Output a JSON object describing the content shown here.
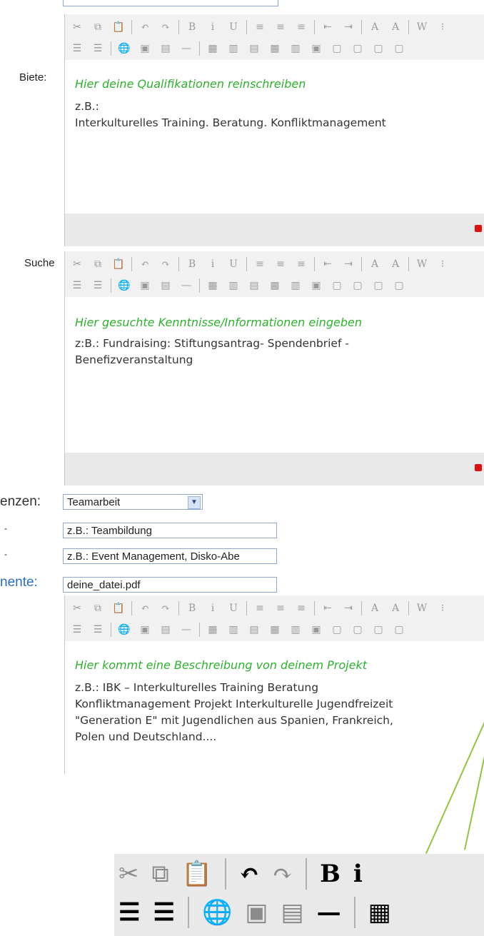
{
  "toolbar": {
    "row1": [
      {
        "name": "cut-icon",
        "glyph": "✂"
      },
      {
        "name": "copy-icon",
        "glyph": "⧉"
      },
      {
        "name": "paste-icon",
        "glyph": "📋"
      },
      {
        "sep": true
      },
      {
        "name": "undo-icon",
        "glyph": "↶"
      },
      {
        "name": "redo-icon",
        "glyph": "↷"
      },
      {
        "sep": true
      },
      {
        "name": "bold-icon",
        "glyph": "B"
      },
      {
        "name": "italic-icon",
        "glyph": "i"
      },
      {
        "name": "underline-icon",
        "glyph": "U"
      },
      {
        "sep": true
      },
      {
        "name": "align-left-icon",
        "glyph": "≡"
      },
      {
        "name": "align-center-icon",
        "glyph": "≡"
      },
      {
        "name": "align-right-icon",
        "glyph": "≡"
      },
      {
        "sep": true
      },
      {
        "name": "outdent-icon",
        "glyph": "⇤"
      },
      {
        "name": "indent-icon",
        "glyph": "⇥"
      },
      {
        "sep": true
      },
      {
        "name": "text-color-icon",
        "glyph": "A"
      },
      {
        "name": "highlight-color-icon",
        "glyph": "A"
      },
      {
        "sep": true
      },
      {
        "name": "word-paste-icon",
        "glyph": "W"
      },
      {
        "name": "grid-icon",
        "glyph": "⁝"
      }
    ],
    "row2": [
      {
        "name": "numbered-list-icon",
        "glyph": "☰"
      },
      {
        "name": "bullet-list-icon",
        "glyph": "☰"
      },
      {
        "sep": true
      },
      {
        "name": "link-icon",
        "glyph": "🌐"
      },
      {
        "name": "image-icon",
        "glyph": "▣"
      },
      {
        "name": "media-icon",
        "glyph": "▤"
      },
      {
        "name": "horizontal-rule-icon",
        "glyph": "—"
      },
      {
        "sep": true
      },
      {
        "name": "table-insert-icon",
        "glyph": "▦"
      },
      {
        "name": "table-props-icon",
        "glyph": "▥"
      },
      {
        "name": "row-insert-icon",
        "glyph": "▤"
      },
      {
        "name": "row-delete-icon",
        "glyph": "▦"
      },
      {
        "name": "column-icon",
        "glyph": "▥"
      },
      {
        "name": "cell-icon",
        "glyph": "▣"
      },
      {
        "name": "merge-icon",
        "glyph": "▢"
      },
      {
        "name": "split-icon",
        "glyph": "▢"
      },
      {
        "name": "cell-props-icon",
        "glyph": "▢"
      },
      {
        "name": "table-delete-icon",
        "glyph": "▢"
      }
    ]
  },
  "editors": [
    {
      "label": "Biete:",
      "hint": "Hier deine Qualifikationen reinschreiben",
      "lines": [
        "z.B.:",
        "Interkulturelles Training. Beratung. Konfliktmanagement"
      ]
    },
    {
      "label": "Suche",
      "hint": "Hier gesuchte Kenntnisse/Informationen eingeben",
      "lines": [
        "z:B.: Fundraising: Stiftungsantrag- Spendenbrief -",
        "Benefizveranstaltung"
      ]
    },
    {
      "label": "",
      "hint": "Hier kommt eine Beschreibung von deinem Projekt",
      "lines": [
        "z.B.: IBK – Interkulturelles Training Beratung",
        "Konfliktmanagement Projekt Interkulturelle Jugendfreizeit",
        "\"Generation E\" mit Jugendlichen aus Spanien, Frankreich,",
        "Polen und Deutschland...."
      ]
    }
  ],
  "fields": {
    "kompetenzen_label": "enzen:",
    "kompetenzen_value": "Teamarbeit",
    "field2_label": "-",
    "field2_value": "z.B.: Teambildung",
    "field3_label": "-",
    "field3_value": "z.B.: Event Management, Disko-Abe",
    "dokumente_label": "nente:",
    "dokumente_value": "deine_datei.pdf"
  },
  "zoom": {
    "row1": [
      {
        "name": "zoom-cut-icon",
        "glyph": "✂"
      },
      {
        "name": "zoom-copy-icon",
        "glyph": "⧉"
      },
      {
        "name": "zoom-paste-icon",
        "glyph": "📋"
      },
      {
        "sep": true
      },
      {
        "name": "zoom-undo-icon",
        "glyph": "↶",
        "on": true
      },
      {
        "name": "zoom-redo-icon",
        "glyph": "↷"
      },
      {
        "sep": true
      },
      {
        "name": "zoom-bold-icon",
        "glyph": "B",
        "on": true
      },
      {
        "name": "zoom-italic-icon",
        "glyph": "i",
        "on": true
      }
    ],
    "row2": [
      {
        "name": "zoom-numbered-list-icon",
        "glyph": "☰",
        "on": true
      },
      {
        "name": "zoom-bullet-list-icon",
        "glyph": "☰",
        "on": true
      },
      {
        "sep": true
      },
      {
        "name": "zoom-link-icon",
        "glyph": "🌐"
      },
      {
        "name": "zoom-image-icon",
        "glyph": "▣"
      },
      {
        "name": "zoom-media-icon",
        "glyph": "▤"
      },
      {
        "name": "zoom-hr-icon",
        "glyph": "—",
        "on": true
      },
      {
        "sep": true
      },
      {
        "name": "zoom-table-icon",
        "glyph": "▦",
        "on": true
      }
    ]
  },
  "colors": {
    "accent_green": "#8fc63f",
    "hint_green": "#2db12d",
    "stop_red": "#d11111",
    "blue_label": "#2a6fbf"
  }
}
